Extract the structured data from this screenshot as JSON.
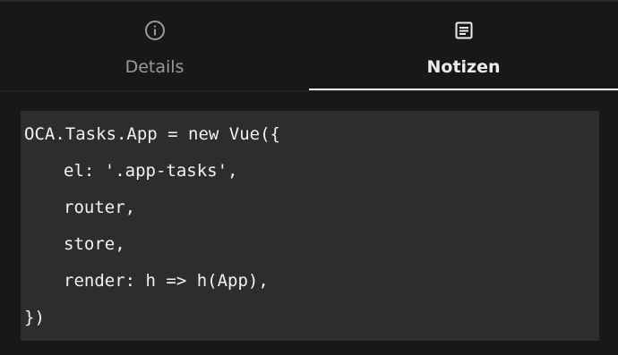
{
  "tabs": [
    {
      "label": "Details",
      "icon": "info-icon",
      "active": false
    },
    {
      "label": "Notizen",
      "icon": "notes-icon",
      "active": true
    }
  ],
  "code": {
    "lines": [
      "OCA.Tasks.App = new Vue({",
      "el: '.app-tasks',",
      "router,",
      "store,",
      "render: h => h(App),",
      "})"
    ]
  },
  "colors": {
    "background": "#181818",
    "code_background": "#2d2d2d",
    "active_underline": "#ffffff",
    "inactive_text": "#9a9a9a",
    "active_text": "#ececec"
  }
}
